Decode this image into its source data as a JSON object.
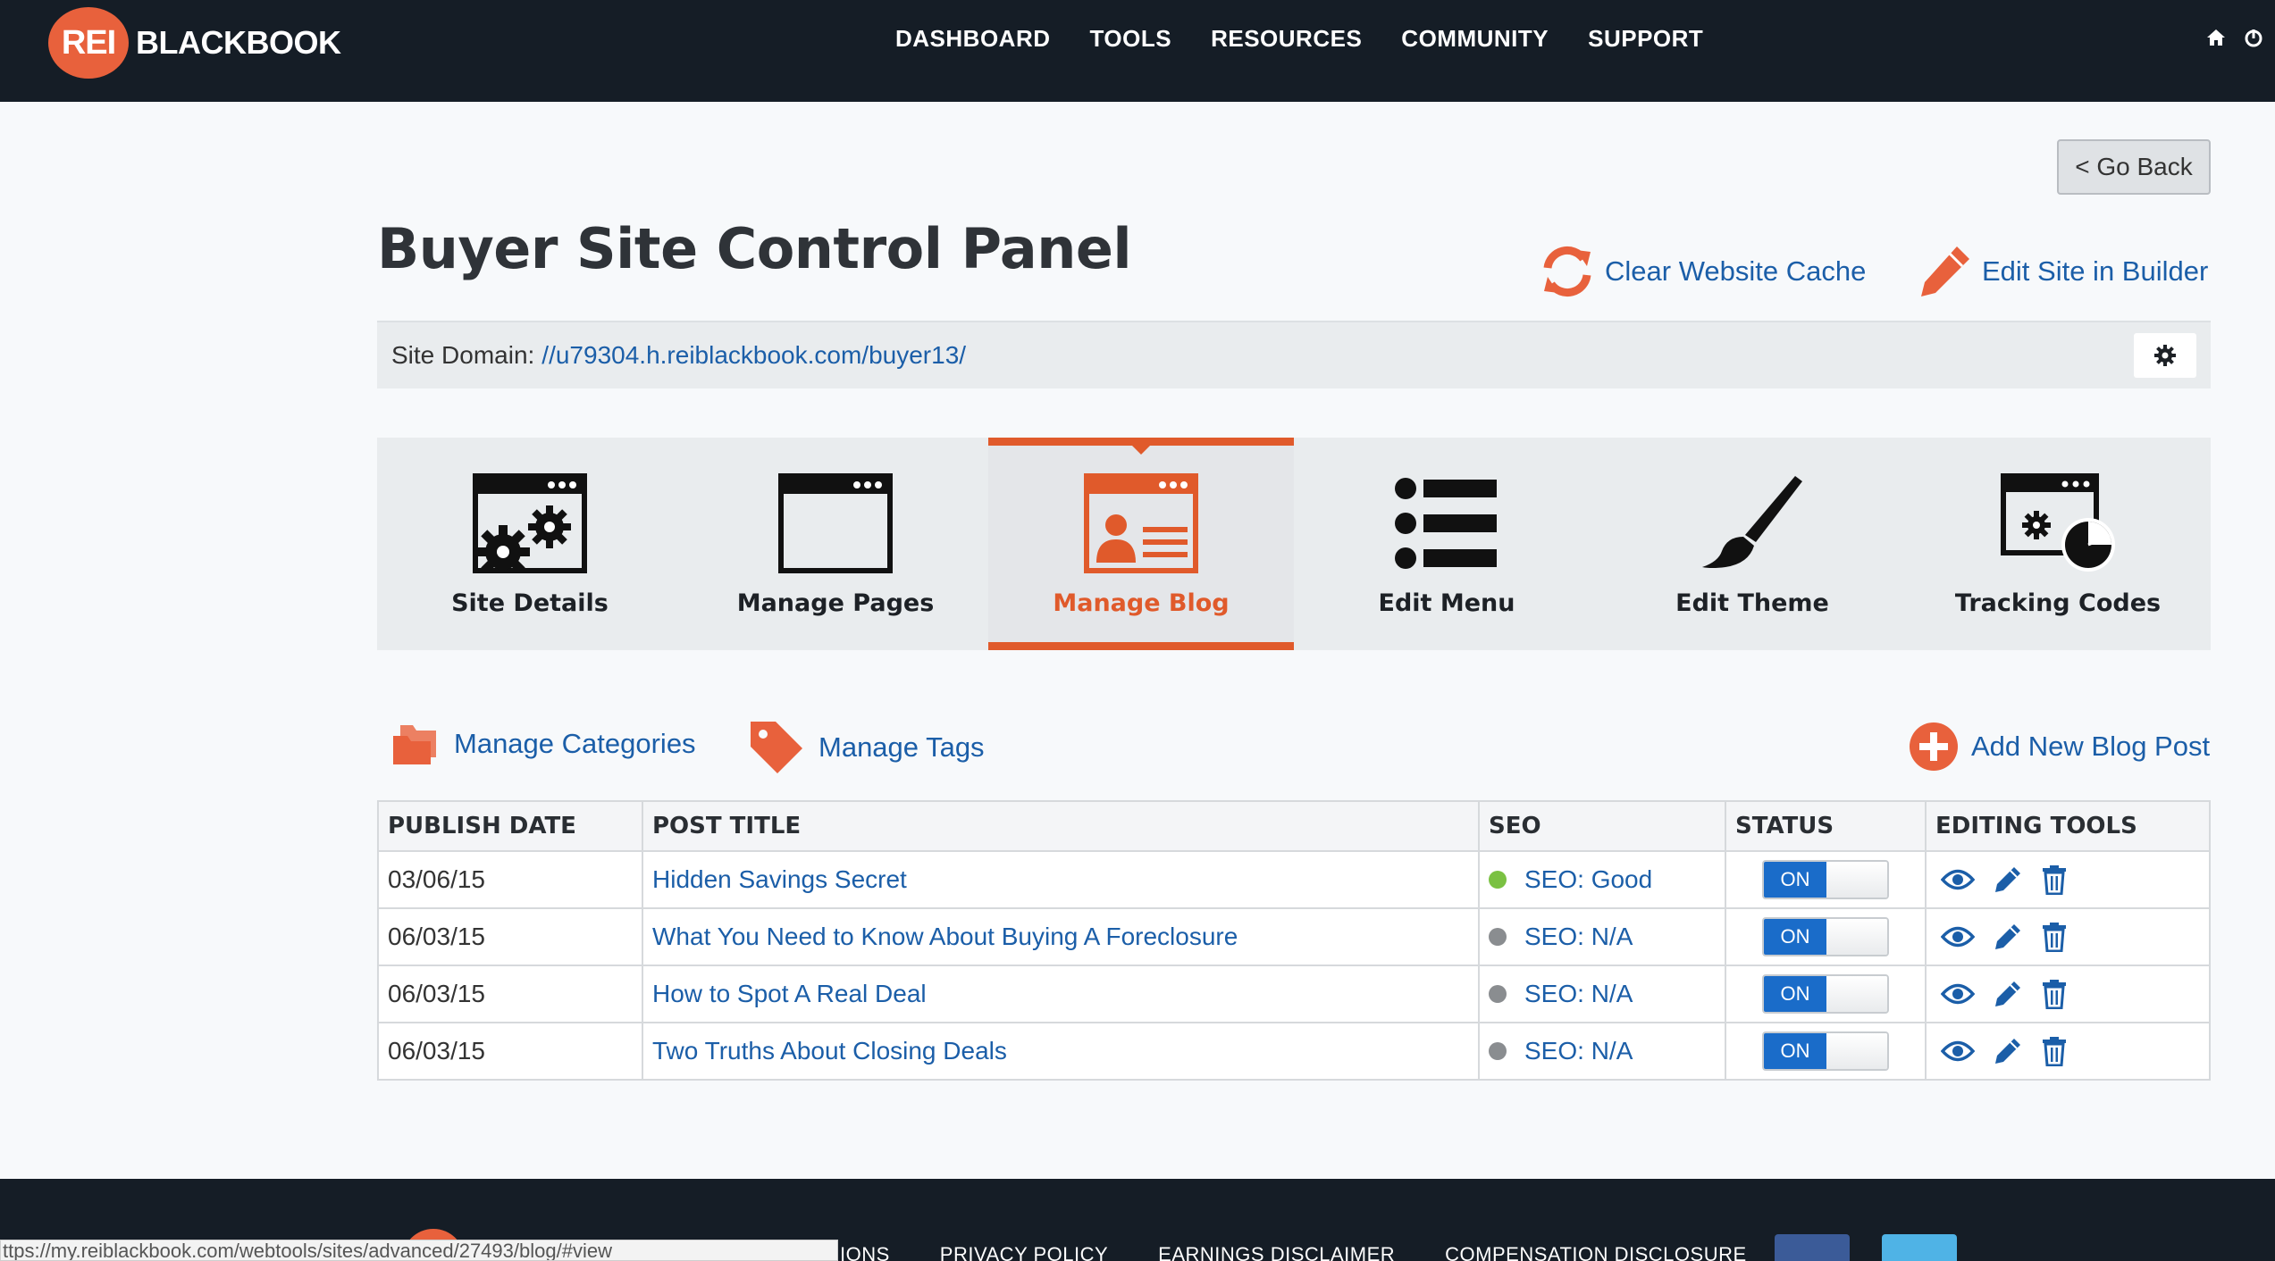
{
  "header": {
    "logo_badge": "REI",
    "logo_text": "BLACKBOOK",
    "nav": [
      "DASHBOARD",
      "TOOLS",
      "RESOURCES",
      "COMMUNITY",
      "SUPPORT"
    ],
    "icons": [
      "home-icon",
      "power-icon"
    ]
  },
  "page": {
    "go_back": "< Go Back",
    "title": "Buyer Site Control Panel",
    "clear_cache": "Clear Website Cache",
    "edit_builder": "Edit Site in Builder",
    "domain_label": "Site Domain:",
    "domain_url": "//u79304.h.reiblackbook.com/buyer13/"
  },
  "tabs": [
    {
      "label": "Site Details",
      "icon": "browser-gear-icon",
      "active": false
    },
    {
      "label": "Manage Pages",
      "icon": "browser-window-icon",
      "active": false
    },
    {
      "label": "Manage Blog",
      "icon": "browser-profile-icon",
      "active": true
    },
    {
      "label": "Edit Menu",
      "icon": "list-icon",
      "active": false
    },
    {
      "label": "Edit Theme",
      "icon": "paintbrush-icon",
      "active": false
    },
    {
      "label": "Tracking Codes",
      "icon": "browser-chart-icon",
      "active": false
    }
  ],
  "blog": {
    "manage_categories": "Manage Categories",
    "manage_tags": "Manage Tags",
    "add_post": "Add New Blog Post",
    "columns": [
      "PUBLISH DATE",
      "POST TITLE",
      "SEO",
      "STATUS",
      "EDITING TOOLS"
    ],
    "rows": [
      {
        "date": "03/06/15",
        "title": "Hidden Savings Secret",
        "seo": "SEO: Good",
        "seo_color": "#7ac142",
        "status": "ON"
      },
      {
        "date": "06/03/15",
        "title": "What You Need to Know About Buying A Foreclosure",
        "seo": "SEO: N/A",
        "seo_color": "#8a8d90",
        "status": "ON"
      },
      {
        "date": "06/03/15",
        "title": "How to Spot A Real Deal",
        "seo": "SEO: N/A",
        "seo_color": "#8a8d90",
        "status": "ON"
      },
      {
        "date": "06/03/15",
        "title": "Two Truths About Closing Deals",
        "seo": "SEO: N/A",
        "seo_color": "#8a8d90",
        "status": "ON"
      }
    ]
  },
  "footer": {
    "links": [
      "IONS",
      "PRIVACY POLICY",
      "EARNINGS DISCLAIMER",
      "COMPENSATION DISCLOSURE"
    ],
    "status_url": "ttps://my.reiblackbook.com/webtools/sites/advanced/27493/blog/#view"
  },
  "colors": {
    "accent": "#e05a2b",
    "link": "#1b5ea8",
    "nav_bg": "#151d26"
  }
}
